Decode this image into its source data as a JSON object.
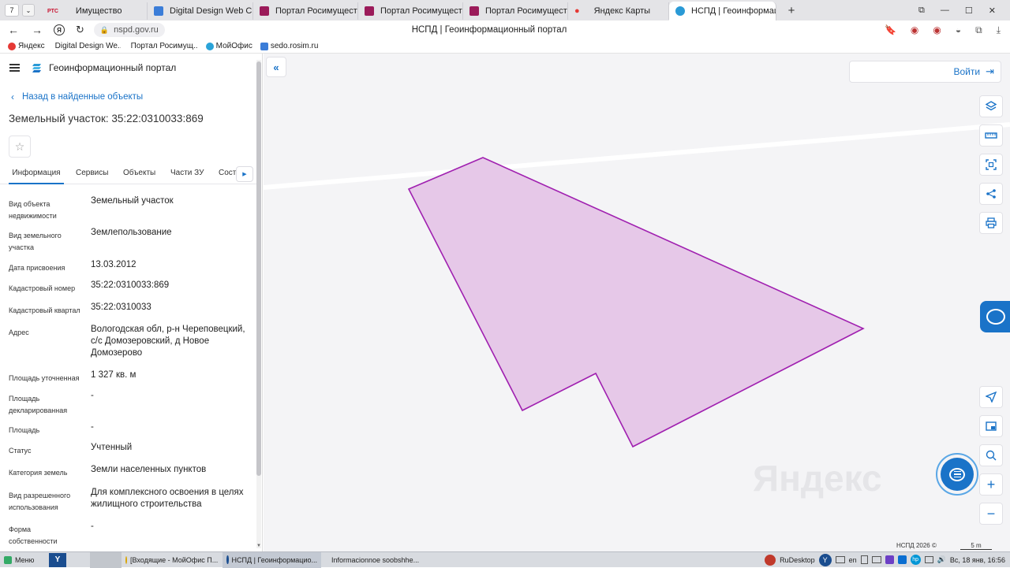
{
  "browser": {
    "tab_count": "7",
    "tabs": [
      {
        "label": "Имущество",
        "fav": "РТС"
      },
      {
        "label": "Digital Design Web Client"
      },
      {
        "label": "Портал Росимущества"
      },
      {
        "label": "Портал Росимущества"
      },
      {
        "label": "Портал Росимущества"
      },
      {
        "label": "Яндекс Карты"
      },
      {
        "label": "НСПД | Геоинформац..."
      }
    ],
    "address": "nspd.gov.ru",
    "page_title": "НСПД | Геоинформационный портал",
    "bookmarks": [
      "Яндекс",
      "Digital Design We...",
      "Портал Росимущ...",
      "МойОфис",
      "sedo.rosim.ru"
    ]
  },
  "portal": {
    "brand": "Геоинформационный портал",
    "back_link": "Назад в найденные объекты",
    "object_title": "Земельный участок: 35:22:0310033:869",
    "tabs": [
      "Информация",
      "Сервисы",
      "Объекты",
      "Части ЗУ",
      "Соста..."
    ],
    "fields": [
      {
        "label": "Вид объекта недвижимости",
        "value": "Земельный участок"
      },
      {
        "label": "Вид земельного участка",
        "value": "Землепользование"
      },
      {
        "label": "Дата присвоения",
        "value": "13.03.2012"
      },
      {
        "label": "Кадастровый номер",
        "value": "35:22:0310033:869"
      },
      {
        "label": "Кадастровый квартал",
        "value": "35:22:0310033"
      },
      {
        "label": "Адрес",
        "value": "Вологодская обл, р-н Череповецкий, с/с Домозеровский, д Новое Домозерово"
      },
      {
        "label": "Площадь уточненная",
        "value": "1 327 кв. м"
      },
      {
        "label": "Площадь декларированная",
        "value": "-"
      },
      {
        "label": "Площадь",
        "value": "-"
      },
      {
        "label": "Статус",
        "value": "Учтенный"
      },
      {
        "label": "Категория земель",
        "value": "Земли населенных пунктов"
      },
      {
        "label": "Вид разрешенного использования",
        "value": "Для комплексного освоения в целях жилищного строительства"
      },
      {
        "label": "Форма собственности",
        "value": "-"
      }
    ],
    "login": "Войти",
    "copyright": "НСПД 2026 ©",
    "scale": "5 m",
    "watermark": "Яндекс",
    "parcel_color": "#e6c8e8",
    "parcel_stroke": "#a020b0",
    "accent": "#1a73c8"
  },
  "taskbar": {
    "menu": "Меню",
    "items": [
      "[Входящие - МойОфис П...",
      "НСПД | Геоинформацио...",
      "Informacionnoe soobshhe..."
    ],
    "rudesktop": "RuDesktop",
    "lang": "en",
    "clock": "Вс, 18 янв, 16:56"
  }
}
